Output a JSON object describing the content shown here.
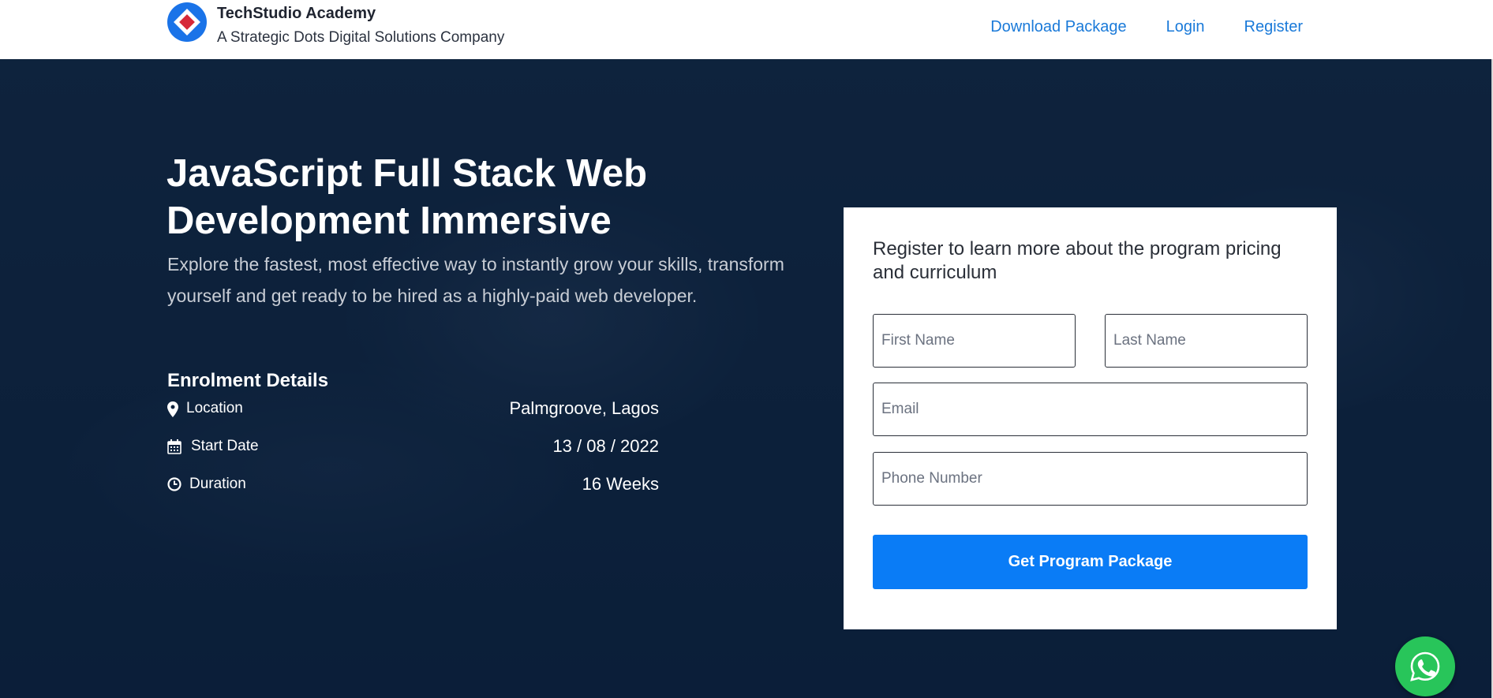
{
  "brand": {
    "name": "TechStudio Academy",
    "tagline": "A Strategic Dots Digital Solutions Company"
  },
  "nav": {
    "download": "Download Package",
    "login": "Login",
    "register": "Register"
  },
  "hero": {
    "title": "JavaScript Full Stack Web Development Immersive",
    "subtitle": "Explore the fastest, most effective way to instantly grow your skills, transform yourself and get ready to be hired as a highly-paid web developer."
  },
  "enrolment": {
    "heading": "Enrolment Details",
    "rows": [
      {
        "icon": "map-pin-icon",
        "label": "Location",
        "value": "Palmgroove, Lagos"
      },
      {
        "icon": "calendar-icon",
        "label": "Start Date",
        "value": "13 / 08 / 2022"
      },
      {
        "icon": "clock-icon",
        "label": "Duration",
        "value": "16 Weeks"
      }
    ]
  },
  "form": {
    "title": "Register to learn more about the program pricing and curriculum",
    "first_name_placeholder": "First Name",
    "last_name_placeholder": "Last Name",
    "email_placeholder": "Email",
    "phone_placeholder": "Phone Number",
    "submit_label": "Get Program Package"
  },
  "colors": {
    "accent": "#0a7cf6",
    "nav_link": "#1a7ad9",
    "hero_overlay": "#0b2440",
    "whatsapp": "#28c55a"
  },
  "icons": {
    "logo": "techstudio-logo-icon",
    "whatsapp": "whatsapp-icon"
  }
}
